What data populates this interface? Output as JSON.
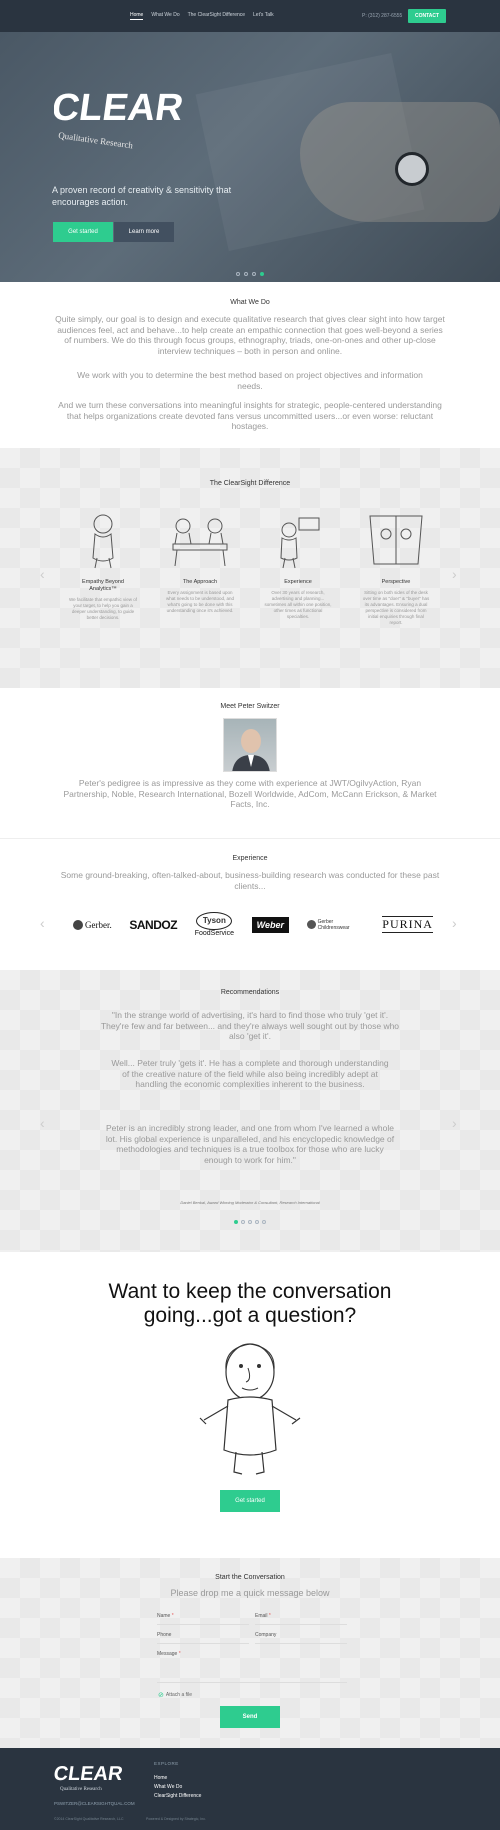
{
  "nav": {
    "links": [
      "Home",
      "What We Do",
      "The ClearSight Difference",
      "Let's Talk"
    ],
    "phone": "P: (312) 287-6555",
    "contact_label": "CONTACT"
  },
  "hero": {
    "logo_text": "CLEAR",
    "logo_subtitle": "Qualitative Research",
    "tagline": "A proven record of creativity & sensitivity that encourages action.",
    "btn_primary": "Get started",
    "btn_secondary": "Learn more"
  },
  "what_we_do": {
    "title": "What We Do",
    "p1": "Quite simply, our goal is to design and execute qualitative research that gives clear sight into how target audiences feel, act and behave...to help create an empathic connection that goes well-beyond a series of numbers. We do this through focus groups, ethnography, triads, one-on-ones and other up-close interview techniques – both in person and online.",
    "p2": "We work with you to determine the best method based on project objectives and information needs.",
    "p3": "And we turn these conversations into meaningful insights for strategic, people-centered understanding that helps organizations create devoted fans versus uncommitted users...or even worse: reluctant hostages."
  },
  "difference": {
    "title": "The ClearSight Difference",
    "items": [
      {
        "title": "Empathy Beyond Analytics™",
        "text": "We facilitate that empathic view of your target, to help you gain a deeper understanding, to guide better decisions."
      },
      {
        "title": "The Approach",
        "text": "Every assignment is based upon what needs to be understood, and what's going to be done with this understanding once it's achieved."
      },
      {
        "title": "Experience",
        "text": "Over 30 years of research, advertising and planning... sometimes all within one position, other times as functional specialties."
      },
      {
        "title": "Perspective",
        "text": "Sitting on both sides of the desk over time as \"doer\" & \"buyer\" has its advantages. Ensuring a dual perspective is considered from initial enquiries through final report."
      }
    ]
  },
  "peter": {
    "title": "Meet Peter Switzer",
    "text": "Peter's pedigree is as impressive as they come with experience at JWT/OgilvyAction, Ryan Partnership, Noble, Research International, Bozell Worldwide, AdCom, McCann Erickson, & Market Facts, Inc."
  },
  "experience": {
    "title": "Experience",
    "text": "Some ground-breaking, often-talked-about, business-building research was conducted for these past clients...",
    "logos": [
      "Gerber.",
      "SANDOZ",
      "Tyson",
      "FoodService",
      "Weber",
      "Gerber Childrenswear",
      "PURINA"
    ]
  },
  "recommendations": {
    "title": "Recommendations",
    "p1": "\"In the strange world of advertising, it's hard to find those who truly 'get it'. They're few and far between... and they're always well sought out by those who also 'get it'.",
    "p2": "Well... Peter truly 'gets it'. He has a complete and thorough understanding of the creative nature of the field while also being incredibly adept at handling the economic complexities inherent to the business.",
    "p3": "Peter is an incredibly strong leader, and one from whom I've learned a whole lot. His global experience is unparalleled, and his encyclopedic knowledge of methodologies and techniques is a true toolbox for those who are lucky enough to work for him.\"",
    "author": "Daniel Benkal, Award Winning Moderator & Consultant, Research International"
  },
  "cta": {
    "title_line1": "Want to keep the conversation",
    "title_line2": "going...got a question?",
    "btn": "Get started"
  },
  "form": {
    "title": "Start the Conversation",
    "subtitle": "Please drop me a quick message below",
    "name_label": "Name",
    "email_label": "Email",
    "phone_label": "Phone",
    "company_label": "Company",
    "message_label": "Message",
    "attach_label": "Attach a file",
    "send_label": "Send",
    "required_mark": "*"
  },
  "footer": {
    "explore_label": "EXPLORE",
    "links": [
      "Home",
      "What We Do",
      "ClearSight Difference"
    ],
    "email": "PSWITZER@CLEARSIGHTQUAL.COM",
    "copyright": "©2014 ClearSight Qualitative Research, LLC",
    "powered": "Powered & Designed by Strategic, Inc."
  },
  "colors": {
    "accent": "#2ecc8f",
    "nav_bg": "#2a3440"
  }
}
